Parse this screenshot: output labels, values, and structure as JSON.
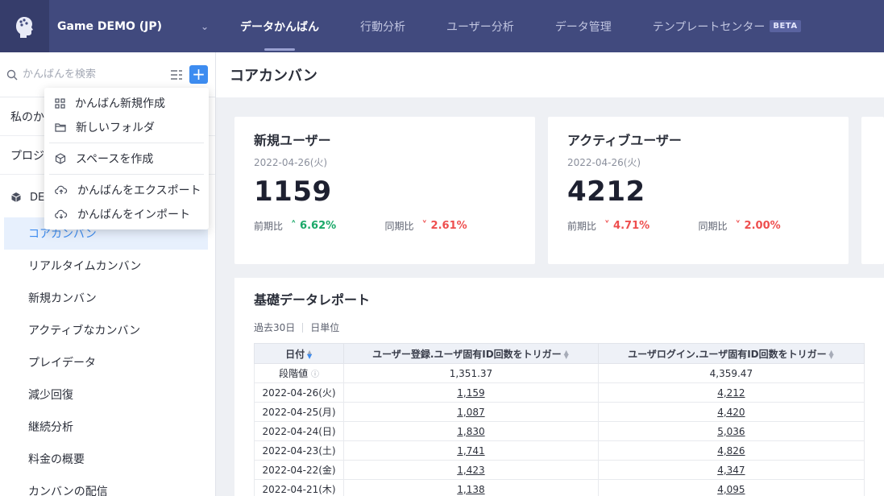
{
  "header": {
    "project_name": "Game DEMO (JP)",
    "nav": [
      {
        "label": "データかんばん",
        "active": true
      },
      {
        "label": "行動分析"
      },
      {
        "label": "ユーザー分析"
      },
      {
        "label": "データ管理"
      },
      {
        "label": "テンプレートセンター",
        "badge": "BETA"
      }
    ]
  },
  "sidebar": {
    "search_placeholder": "かんばんを検索",
    "sections": [
      "私のか",
      "プロジ"
    ],
    "group_label": "DE",
    "items": [
      "コアカンバン",
      "リアルタイムカンバン",
      "新規カンバン",
      "アクティブなカンバン",
      "プレイデータ",
      "減少回復",
      "継続分析",
      "料金の概要",
      "カンバンの配信"
    ]
  },
  "dropdown": {
    "items": [
      {
        "label": "かんばん新規作成",
        "icon": "grid-icon"
      },
      {
        "label": "新しいフォルダ",
        "icon": "folder-icon"
      },
      {
        "label": "スペースを作成",
        "icon": "cube-icon"
      },
      {
        "label": "かんばんをエクスポート",
        "icon": "cloud-upload-icon"
      },
      {
        "label": "かんばんをインポート",
        "icon": "cloud-download-icon"
      }
    ]
  },
  "main": {
    "title": "コアカンバン",
    "cards": [
      {
        "title": "新規ユーザー",
        "date": "2022-04-26(火)",
        "value": "1159",
        "mom_label": "前期比",
        "mom": "6.62%",
        "mom_dir": "up",
        "yoy_label": "同期比",
        "yoy": "2.61%",
        "yoy_dir": "down"
      },
      {
        "title": "アクティブユーザー",
        "date": "2022-04-26(火)",
        "value": "4212",
        "mom_label": "前期比",
        "mom": "4.71%",
        "mom_dir": "down",
        "yoy_label": "同期比",
        "yoy": "2.00%",
        "yoy_dir": "down"
      }
    ],
    "report": {
      "title": "基礎データレポート",
      "range": "過去30日",
      "unit": "日単位",
      "columns": [
        "日付",
        "ユーザー登録.ユーザ固有ID回数をトリガー",
        "ユーザログイン.ユーザ固有ID回数をトリガー"
      ],
      "stage_label": "段階値",
      "stage_values": [
        "1,351.37",
        "4,359.47"
      ],
      "rows": [
        [
          "2022-04-26(火)",
          "1,159",
          "4,212"
        ],
        [
          "2022-04-25(月)",
          "1,087",
          "4,420"
        ],
        [
          "2022-04-24(日)",
          "1,830",
          "5,036"
        ],
        [
          "2022-04-23(土)",
          "1,741",
          "4,826"
        ],
        [
          "2022-04-22(金)",
          "1,423",
          "4,347"
        ],
        [
          "2022-04-21(木)",
          "1,138",
          "4,095"
        ]
      ]
    }
  }
}
